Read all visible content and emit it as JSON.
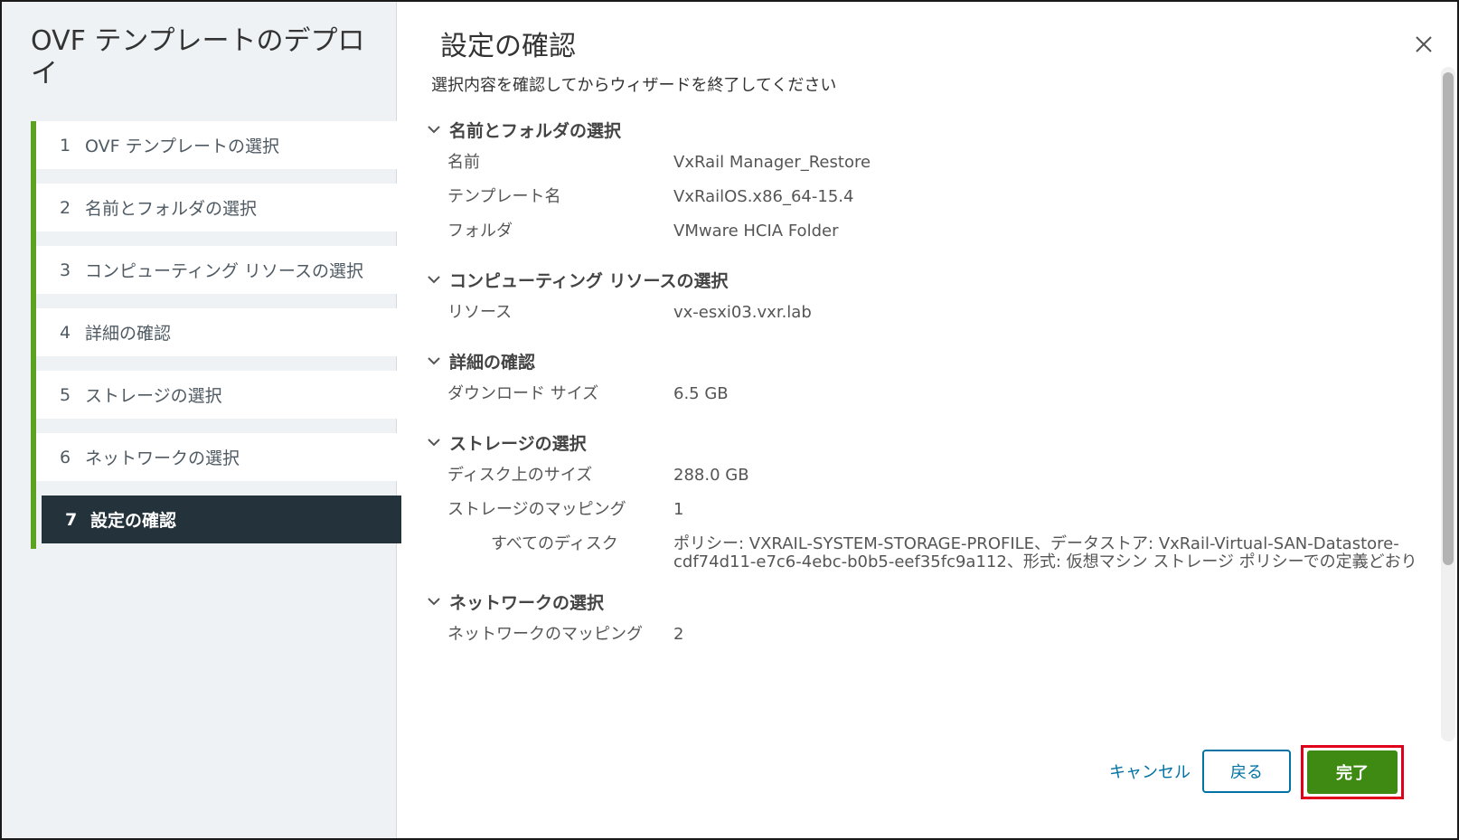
{
  "wizard": {
    "title": "OVF テンプレートのデプロイ",
    "steps": [
      {
        "num": "1",
        "label": "OVF テンプレートの選択"
      },
      {
        "num": "2",
        "label": "名前とフォルダの選択"
      },
      {
        "num": "3",
        "label": "コンピューティング リソースの選択"
      },
      {
        "num": "4",
        "label": "詳細の確認"
      },
      {
        "num": "5",
        "label": "ストレージの選択"
      },
      {
        "num": "6",
        "label": "ネットワークの選択"
      },
      {
        "num": "7",
        "label": "設定の確認"
      }
    ]
  },
  "page": {
    "title": "設定の確認",
    "subtitle": "選択内容を確認してからウィザードを終了してください",
    "close_icon": "close-icon"
  },
  "sections": [
    {
      "heading": "名前とフォルダの選択",
      "rows": [
        {
          "key": "名前",
          "value": "VxRail Manager_Restore"
        },
        {
          "key": "テンプレート名",
          "value": "VxRailOS.x86_64-15.4"
        },
        {
          "key": "フォルダ",
          "value": "VMware HCIA Folder"
        }
      ]
    },
    {
      "heading": "コンピューティング リソースの選択",
      "rows": [
        {
          "key": "リソース",
          "value": "vx-esxi03.vxr.lab"
        }
      ]
    },
    {
      "heading": "詳細の確認",
      "rows": [
        {
          "key": "ダウンロード サイズ",
          "value": "6.5 GB"
        }
      ]
    },
    {
      "heading": "ストレージの選択",
      "rows": [
        {
          "key": "ディスク上のサイズ",
          "value": "288.0 GB"
        },
        {
          "key": "ストレージのマッピング",
          "value": "1"
        },
        {
          "key": "すべてのディスク",
          "value": "ポリシー: VXRAIL-SYSTEM-STORAGE-PROFILE、データストア: VxRail-Virtual-SAN-Datastore-cdf74d11-e7c6-4ebc-b0b5-eef35fc9a112、形式: 仮想マシン ストレージ ポリシーでの定義どおり"
        }
      ]
    },
    {
      "heading": "ネットワークの選択",
      "rows": [
        {
          "key": "ネットワークのマッピング",
          "value": "2"
        }
      ]
    }
  ],
  "footer": {
    "cancel_label": "キャンセル",
    "back_label": "戻る",
    "finish_label": "完了"
  },
  "colors": {
    "accent_green": "#5aa220",
    "finish_green": "#3f8a12",
    "link_blue": "#0072a3",
    "active_step_bg": "#23323b",
    "highlight_red": "#e0001b"
  }
}
